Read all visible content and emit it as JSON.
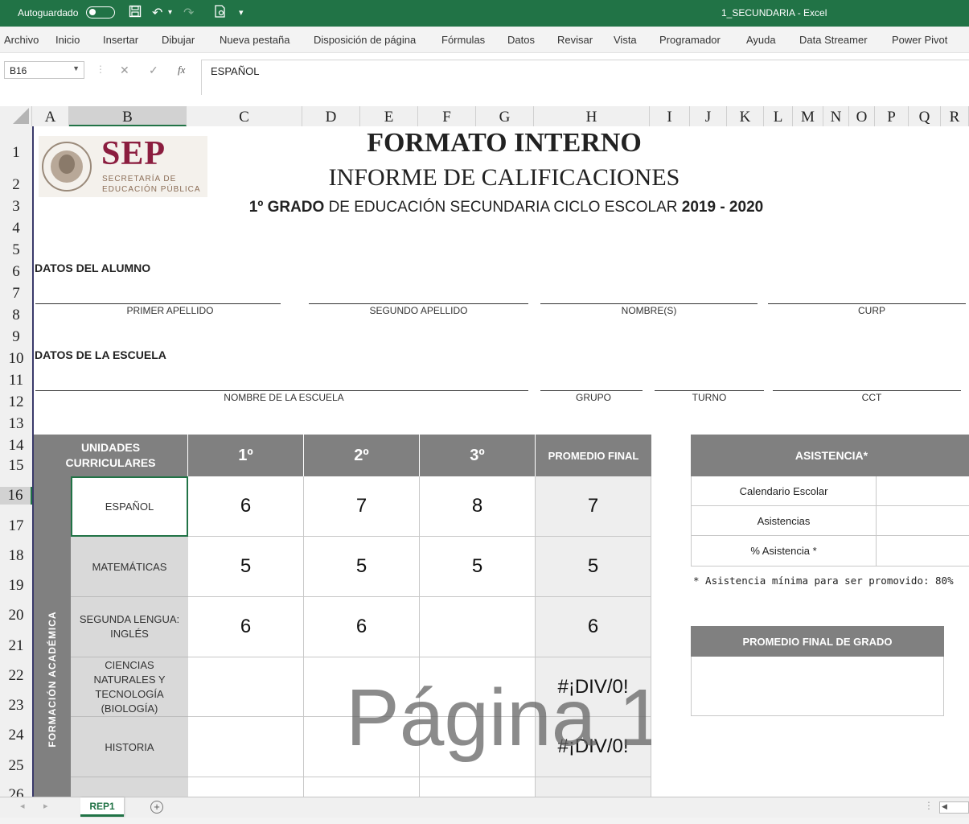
{
  "titlebar": {
    "autosave_label": "Autoguardado",
    "doc_title": "1_SECUNDARIA  -  Excel"
  },
  "ribbon": [
    "Archivo",
    "Inicio",
    "Insertar",
    "Dibujar",
    "Nueva pestaña",
    "Disposición de página",
    "Fórmulas",
    "Datos",
    "Revisar",
    "Vista",
    "Programador",
    "Ayuda",
    "Data Streamer",
    "Power Pivot"
  ],
  "formula": {
    "cell_ref": "B16",
    "fx": "fx",
    "content": "ESPAÑOL"
  },
  "columns": [
    "A",
    "B",
    "C",
    "D",
    "E",
    "F",
    "G",
    "H",
    "I",
    "J",
    "K",
    "L",
    "M",
    "N",
    "O",
    "P",
    "Q",
    "R"
  ],
  "rows": [
    "1",
    "2",
    "3",
    "4",
    "5",
    "6",
    "7",
    "8",
    "9",
    "10",
    "11",
    "12",
    "13",
    "14",
    "15",
    "16",
    "17",
    "18",
    "19",
    "20",
    "21",
    "22",
    "23",
    "24",
    "25",
    "26"
  ],
  "sheet": {
    "logo_text": "SEP",
    "logo_sub1": "SECRETARÍA DE",
    "logo_sub2": "EDUCACIÓN PÚBLICA",
    "title1": "FORMATO INTERNO",
    "title2": "INFORME  DE  CALIFICACIONES",
    "grade_bold": "1º GRADO",
    "grade_rest": " DE EDUCACIÓN SECUNDARIA    CICLO ESCOLAR ",
    "cycle": "2019 - 2020",
    "student_section": "DATOS DEL ALUMNO",
    "student_fields": [
      "PRIMER APELLIDO",
      "SEGUNDO APELLIDO",
      "NOMBRE(S)",
      "CURP"
    ],
    "school_section": "DATOS DE LA ESCUELA",
    "school_fields": [
      "NOMBRE DE LA ESCUELA",
      "GRUPO",
      "TURNO",
      "CCT"
    ],
    "table_header": {
      "units": "UNIDADES CURRICULARES",
      "p1": "1º",
      "p2": "2º",
      "p3": "3º",
      "final": "PROMEDIO FINAL"
    },
    "side_label": "FORMACIÓN ACADÉMICA",
    "subjects": [
      {
        "name": "ESPAÑOL",
        "p1": "6",
        "p2": "7",
        "p3": "8",
        "final": "7"
      },
      {
        "name": "MATEMÁTICAS",
        "p1": "5",
        "p2": "5",
        "p3": "5",
        "final": "5"
      },
      {
        "name": "SEGUNDA LENGUA: INGLÉS",
        "p1": "6",
        "p2": "6",
        "p3": "",
        "final": "6"
      },
      {
        "name": "CIENCIAS NATURALES Y TECNOLOGÍA (BIOLOGÍA)",
        "p1": "",
        "p2": "",
        "p3": "",
        "final": "#¡DIV/0!"
      },
      {
        "name": "HISTORIA",
        "p1": "",
        "p2": "",
        "p3": "",
        "final": "#¡DIV/0!"
      }
    ],
    "attendance": {
      "title": "ASISTENCIA*",
      "rows": [
        "Calendario Escolar",
        "Asistencias",
        "% Asistencia *"
      ],
      "note": "* Asistencia mínima para ser promovido: 80%"
    },
    "final_grade_title": "PROMEDIO FINAL DE GRADO",
    "watermark": "Página 1"
  },
  "tabs": {
    "active": "REP1"
  }
}
